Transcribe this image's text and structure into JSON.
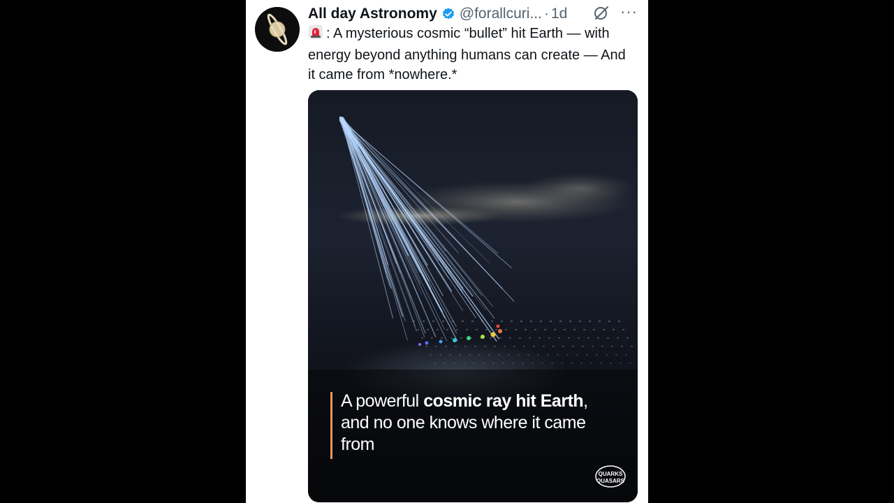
{
  "tweet": {
    "display_name": "All day Astronomy",
    "handle": "@forallcuri...",
    "separator": "·",
    "timestamp": "1d",
    "more_label": "···",
    "text": ": A mysterious cosmic “bullet” hit Earth — with energy beyond anything humans can create — And it came from *nowhere.*",
    "icons": {
      "avatar": "saturn-avatar",
      "verified": "verified-badge-icon",
      "grok": "grok-icon",
      "more": "more-icon",
      "siren": "siren-emoji-icon"
    },
    "colors": {
      "verified": "#1d9bf0",
      "caption_accent": "#e59a5c"
    }
  },
  "media": {
    "caption_part1": "A powerful ",
    "caption_bold1": "cosmic ray hit Earth",
    "caption_part2": ", and no one knows where it came from",
    "watermark": "QUARKS & QUASARS",
    "watermark_line1": "QUARKS",
    "watermark_line2": "QUASARS"
  }
}
